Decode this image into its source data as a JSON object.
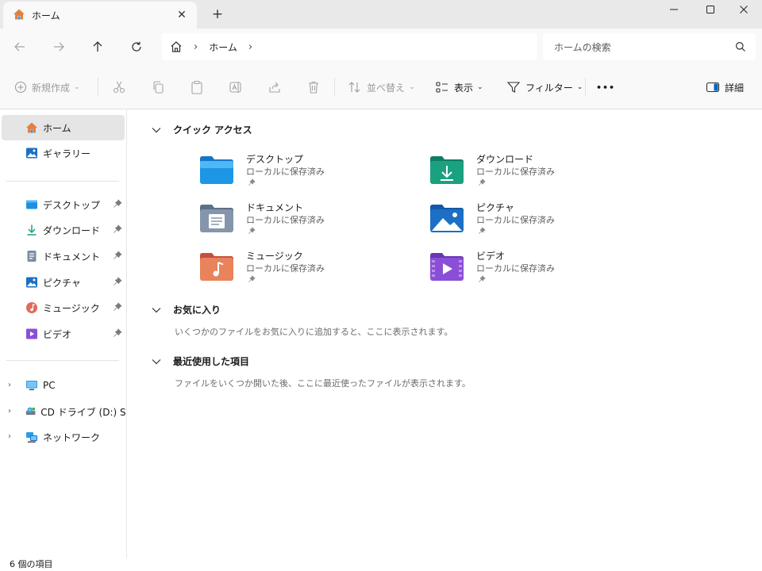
{
  "tab": {
    "title": "ホーム"
  },
  "address": {
    "crumbs": [
      "ホーム"
    ]
  },
  "search": {
    "placeholder": "ホームの検索"
  },
  "toolbar": {
    "new_label": "新規作成",
    "sort_label": "並べ替え",
    "view_label": "表示",
    "filter_label": "フィルター",
    "more_label": "•••",
    "details_label": "詳細"
  },
  "sidebar": {
    "home": "ホーム",
    "gallery": "ギャラリー",
    "pinned": [
      "デスクトップ",
      "ダウンロード",
      "ドキュメント",
      "ピクチャ",
      "ミュージック",
      "ビデオ"
    ],
    "pc": "PC",
    "cd": "CD ドライブ (D:) SSS_",
    "network": "ネットワーク"
  },
  "quick_access": {
    "title": "クイック アクセス",
    "items": [
      {
        "name": "デスクトップ",
        "status": "ローカルに保存済み"
      },
      {
        "name": "ダウンロード",
        "status": "ローカルに保存済み"
      },
      {
        "name": "ドキュメント",
        "status": "ローカルに保存済み"
      },
      {
        "name": "ピクチャ",
        "status": "ローカルに保存済み"
      },
      {
        "name": "ミュージック",
        "status": "ローカルに保存済み"
      },
      {
        "name": "ビデオ",
        "status": "ローカルに保存済み"
      }
    ]
  },
  "favorites": {
    "title": "お気に入り",
    "empty": "いくつかのファイルをお気に入りに追加すると、ここに表示されます。"
  },
  "recent": {
    "title": "最近使用した項目",
    "empty": "ファイルをいくつか開いた後、ここに最近使ったファイルが表示されます。"
  },
  "status": {
    "count": "6 個の項目"
  },
  "colors": {
    "accent": "#0067c0",
    "home_icon": "#e3803f",
    "selected_bg": "#e5e5e5",
    "downloads_folder": "#1aa180",
    "music_folder": "#e06c5a",
    "video_folder": "#8a4fd6"
  }
}
